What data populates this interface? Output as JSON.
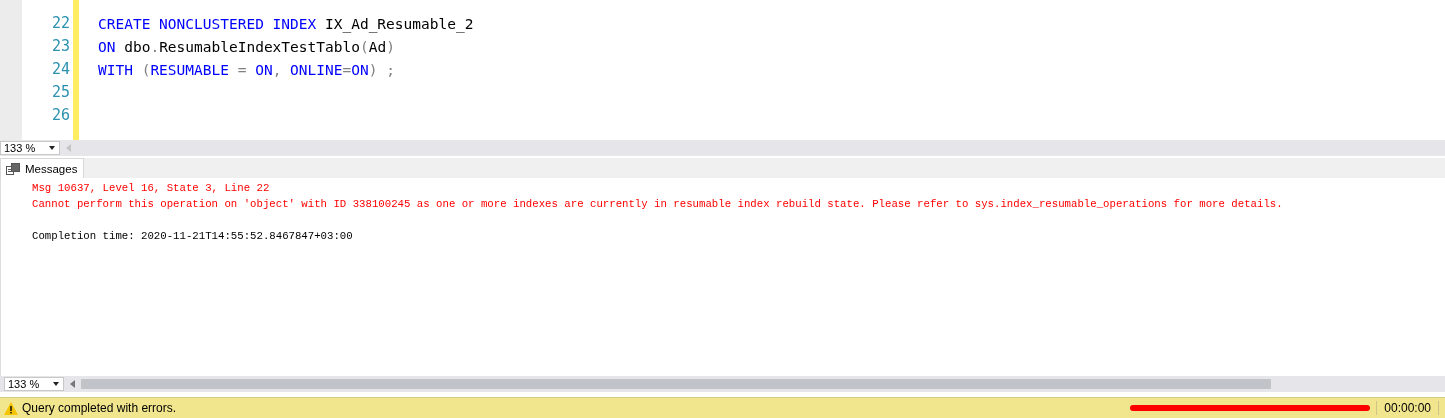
{
  "editor": {
    "lines": [
      {
        "number": "22",
        "tokens": [
          {
            "kind": "keyword",
            "text": "CREATE NONCLUSTERED INDEX"
          },
          {
            "kind": "name",
            "text": " IX_Ad_Resumable_2"
          }
        ]
      },
      {
        "number": "23",
        "tokens": [
          {
            "kind": "keyword",
            "text": "ON"
          },
          {
            "kind": "name",
            "text": " dbo"
          },
          {
            "kind": "punct",
            "text": "."
          },
          {
            "kind": "name",
            "text": "ResumableIndexTestTablo"
          },
          {
            "kind": "punct",
            "text": "("
          },
          {
            "kind": "name",
            "text": "Ad"
          },
          {
            "kind": "punct",
            "text": ")"
          }
        ]
      },
      {
        "number": "24",
        "tokens": [
          {
            "kind": "keyword",
            "text": "WITH"
          },
          {
            "kind": "punct",
            "text": " ("
          },
          {
            "kind": "keyword",
            "text": "RESUMABLE"
          },
          {
            "kind": "punct",
            "text": " = "
          },
          {
            "kind": "keyword",
            "text": "ON"
          },
          {
            "kind": "punct",
            "text": ", "
          },
          {
            "kind": "keyword",
            "text": "ONLINE"
          },
          {
            "kind": "punct",
            "text": "="
          },
          {
            "kind": "keyword",
            "text": "ON"
          },
          {
            "kind": "punct",
            "text": ") ;"
          }
        ]
      },
      {
        "number": "25"
      },
      {
        "number": "26"
      }
    ],
    "zoom": "133 %"
  },
  "results": {
    "tabs": [
      {
        "label": "Messages",
        "selected": true
      }
    ],
    "messages": [
      {
        "kind": "error",
        "text": "Msg 10637, Level 16, State 3, Line 22"
      },
      {
        "kind": "error",
        "text": "Cannot perform this operation on 'object' with ID 338100245 as one or more indexes are currently in resumable index rebuild state. Please refer to sys.index_resumable_operations for more details."
      },
      {
        "kind": "blank"
      },
      {
        "kind": "info",
        "text": "Completion time: 2020-11-21T14:55:52.8467847+03:00"
      }
    ],
    "zoom": "133 %"
  },
  "status_bar": {
    "message": "Query completed with errors.",
    "elapsed": "00:00:00"
  }
}
